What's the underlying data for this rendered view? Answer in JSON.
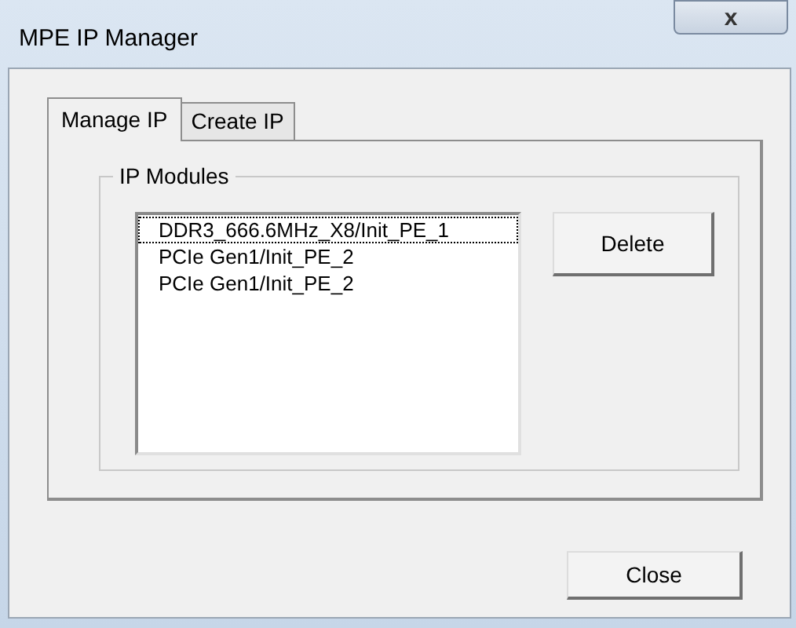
{
  "window": {
    "title": "MPE IP Manager",
    "close_glyph": "x"
  },
  "tabs": [
    {
      "label": "Manage IP",
      "selected": true
    },
    {
      "label": "Create IP",
      "selected": false
    }
  ],
  "group": {
    "title": "IP Modules"
  },
  "modules": [
    {
      "label": "DDR3_666.6MHz_X8/Init_PE_1",
      "focused": true
    },
    {
      "label": "PCIe Gen1/Init_PE_2",
      "focused": false
    },
    {
      "label": "PCIe Gen1/Init_PE_2",
      "focused": false
    }
  ],
  "delete_button": "Delete",
  "close_button": "Close"
}
